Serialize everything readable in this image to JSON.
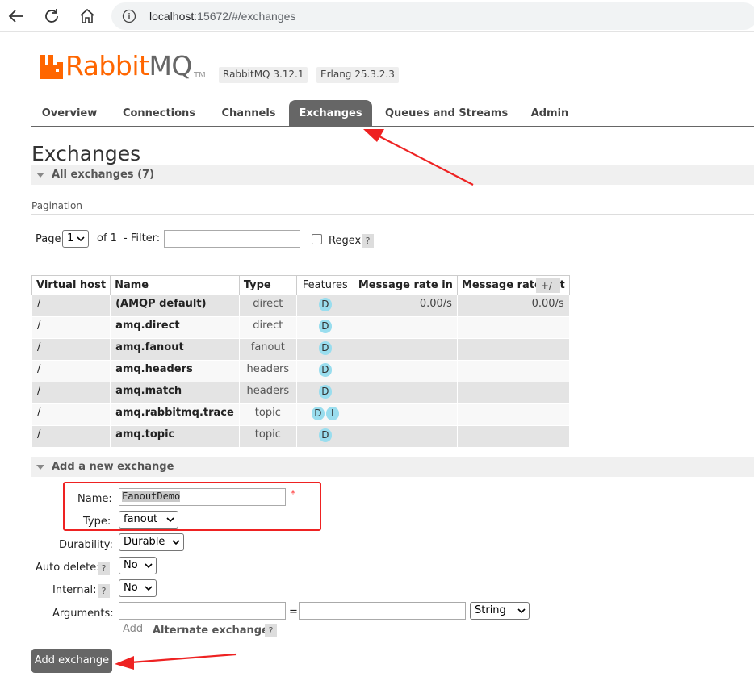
{
  "browser": {
    "url_host": "localhost",
    "url_rest": ":15672/#/exchanges"
  },
  "brand": {
    "logo_rabbit": "Rabbit",
    "logo_mq": "MQ",
    "trademark": "TM",
    "rabbitmq_version": "RabbitMQ 3.12.1",
    "erlang_version": "Erlang 25.3.2.3",
    "accent_color": "#ff6600"
  },
  "tabs": [
    {
      "label": "Overview"
    },
    {
      "label": "Connections"
    },
    {
      "label": "Channels"
    },
    {
      "label": "Exchanges",
      "active": true
    },
    {
      "label": "Queues and Streams"
    },
    {
      "label": "Admin"
    }
  ],
  "page_title": "Exchanges",
  "all_exchanges": {
    "header": "All exchanges (7)",
    "pagination_label": "Pagination",
    "page_label": "Page",
    "page_value": "1",
    "of_label": "of 1",
    "filter_label": "- Filter:",
    "filter_value": "",
    "regex_label": "Regex",
    "help_glyph": "?",
    "columns_toggle": "+/-"
  },
  "table": {
    "columns": [
      "Virtual host",
      "Name",
      "Type",
      "Features",
      "Message rate in",
      "Message rate out"
    ],
    "rows": [
      {
        "vhost": "/",
        "name": "(AMQP default)",
        "type": "direct",
        "features": [
          "D"
        ],
        "rate_in": "0.00/s",
        "rate_out": "0.00/s"
      },
      {
        "vhost": "/",
        "name": "amq.direct",
        "type": "direct",
        "features": [
          "D"
        ],
        "rate_in": "",
        "rate_out": ""
      },
      {
        "vhost": "/",
        "name": "amq.fanout",
        "type": "fanout",
        "features": [
          "D"
        ],
        "rate_in": "",
        "rate_out": ""
      },
      {
        "vhost": "/",
        "name": "amq.headers",
        "type": "headers",
        "features": [
          "D"
        ],
        "rate_in": "",
        "rate_out": ""
      },
      {
        "vhost": "/",
        "name": "amq.match",
        "type": "headers",
        "features": [
          "D"
        ],
        "rate_in": "",
        "rate_out": ""
      },
      {
        "vhost": "/",
        "name": "amq.rabbitmq.trace",
        "type": "topic",
        "features": [
          "D",
          "I"
        ],
        "rate_in": "",
        "rate_out": ""
      },
      {
        "vhost": "/",
        "name": "amq.topic",
        "type": "topic",
        "features": [
          "D"
        ],
        "rate_in": "",
        "rate_out": ""
      }
    ]
  },
  "add_exchange": {
    "header": "Add a new exchange",
    "name_label": "Name:",
    "name_value": "FanoutDemo",
    "required_mark": "*",
    "type_label": "Type:",
    "type_value": "fanout",
    "durability_label": "Durability:",
    "durability_value": "Durable",
    "auto_delete_label": "Auto delete:",
    "auto_delete_value": "No",
    "internal_label": "Internal:",
    "internal_value": "No",
    "arguments_label": "Arguments:",
    "equals": "=",
    "arg_type_value": "String",
    "add_link": "Add",
    "alternate_exchange": "Alternate exchange",
    "help_glyph": "?",
    "submit_label": "Add exchange"
  }
}
